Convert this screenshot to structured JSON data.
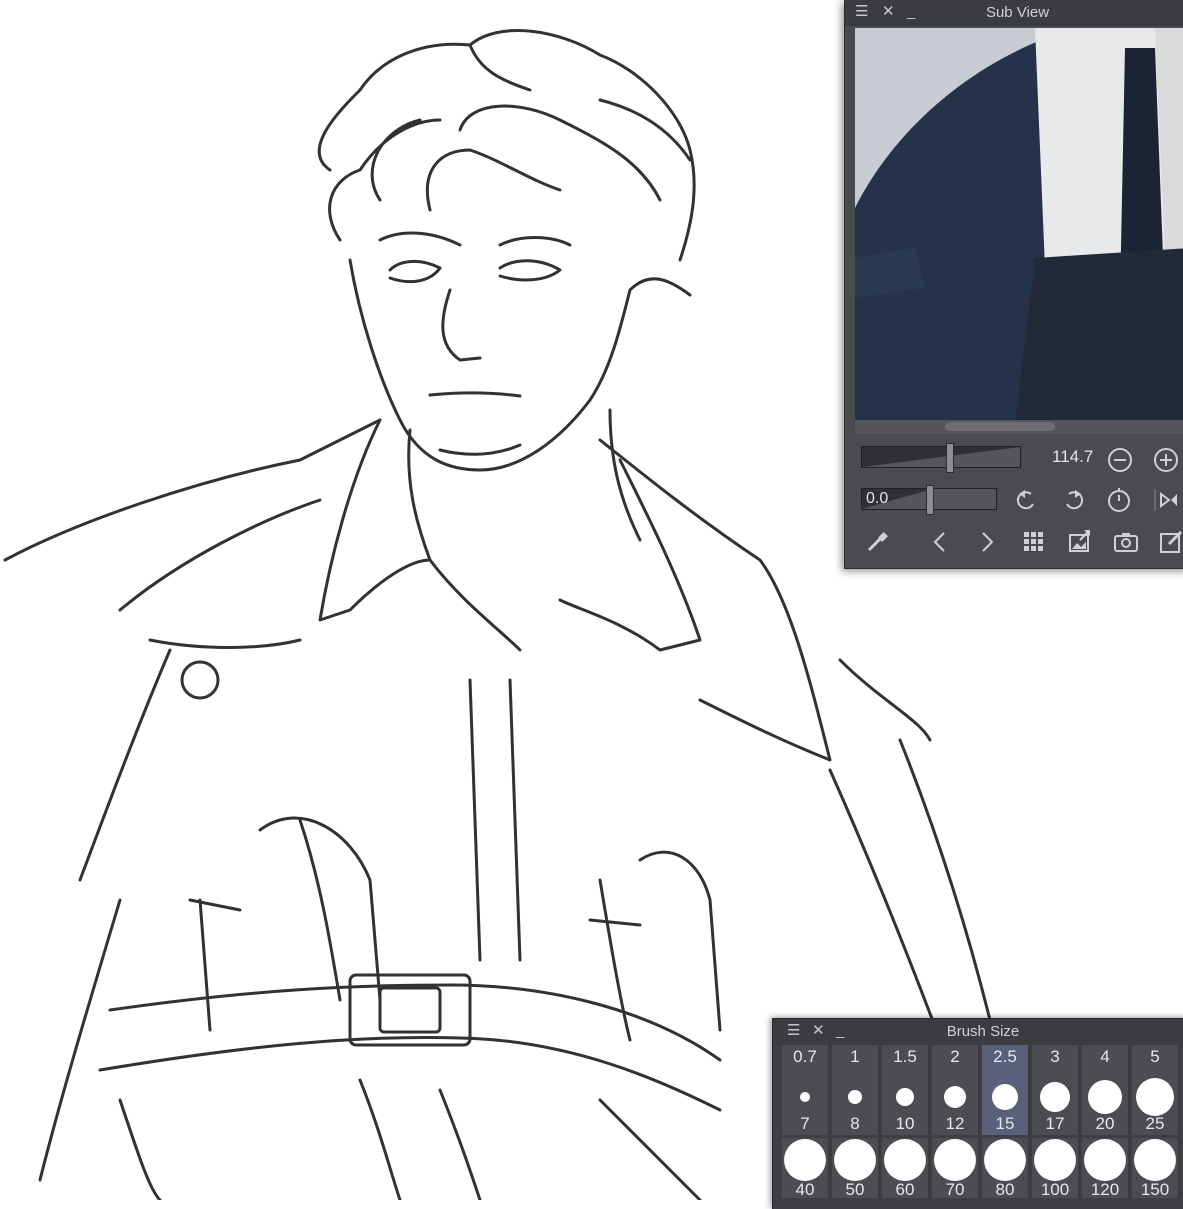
{
  "sub_view": {
    "title": "Sub View",
    "zoom_value": "114.7",
    "rotation_value": "0.0",
    "zoom_level": 0.55,
    "rotation_level": 0.5
  },
  "brush_size": {
    "title": "Brush Size",
    "row1_top_labels": [
      "0.7",
      "1",
      "1.5",
      "2",
      "2.5",
      "3",
      "4",
      "5"
    ],
    "row1_bottom_labels": [
      "7",
      "8",
      "10",
      "12",
      "15",
      "17",
      "20",
      "25"
    ],
    "row2_bottom_labels": [
      "40",
      "50",
      "60",
      "70",
      "80",
      "100",
      "120",
      "150"
    ],
    "selected": "15"
  },
  "colors": {
    "panel_bg": "#4a4b4f",
    "titlebar_bg": "#3b3c40",
    "selected_cell": "#5a5f7a",
    "ink": "#2e2e2e"
  }
}
